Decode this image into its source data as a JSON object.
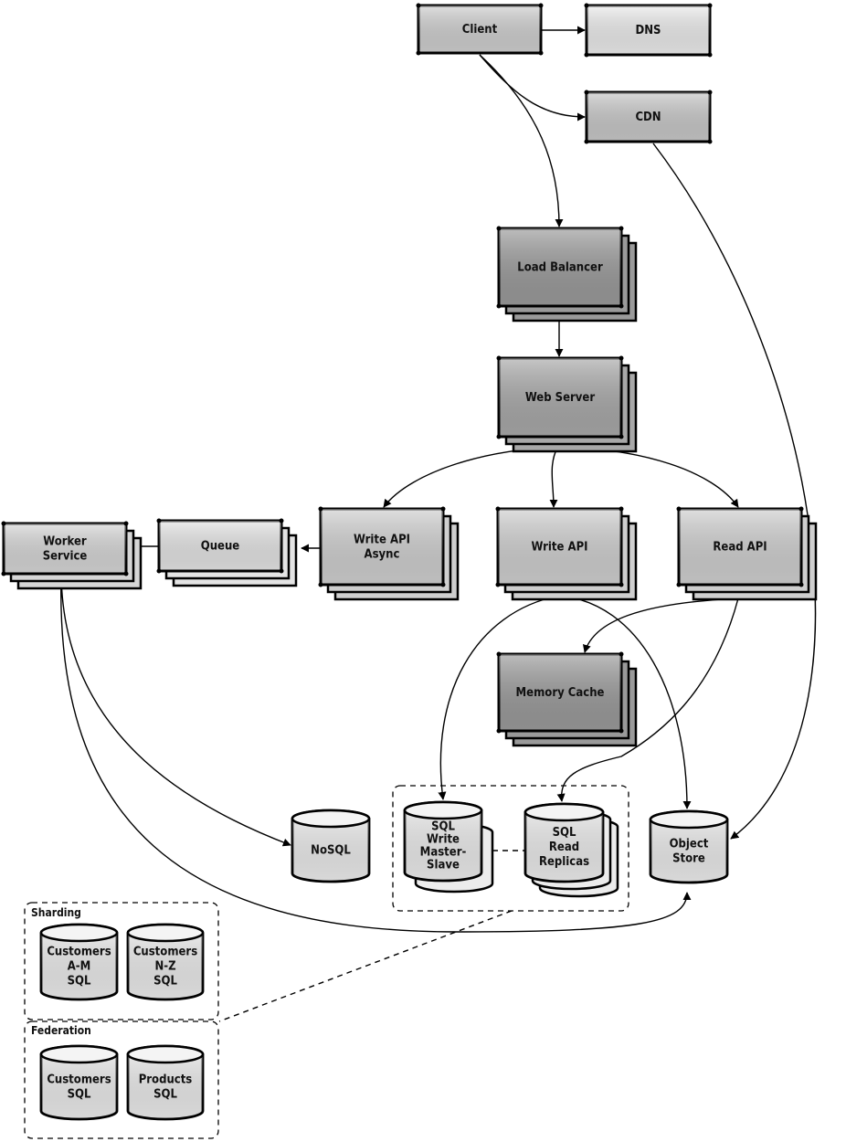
{
  "nodes": {
    "client": {
      "lines": [
        "Client"
      ],
      "shape": "box",
      "fill": "#cfcfcf"
    },
    "dns": {
      "lines": [
        "DNS"
      ],
      "shape": "box",
      "fill": "#ececec"
    },
    "cdn": {
      "lines": [
        "CDN"
      ],
      "shape": "box",
      "fill": "#c8c8c8"
    },
    "load_balancer": {
      "lines": [
        "Load Balancer"
      ],
      "shape": "stacked-box",
      "fill": "#9a9a9a"
    },
    "web_server": {
      "lines": [
        "Web Server"
      ],
      "shape": "stacked-box",
      "fill": "#a8a8a8"
    },
    "write_api_async": {
      "lines": [
        "Write API",
        "Async"
      ],
      "shape": "stacked-box",
      "fill": "#cfcfcf"
    },
    "write_api": {
      "lines": [
        "Write API"
      ],
      "shape": "stacked-box",
      "fill": "#cfcfcf"
    },
    "read_api": {
      "lines": [
        "Read API"
      ],
      "shape": "stacked-box",
      "fill": "#cfcfcf"
    },
    "queue": {
      "lines": [
        "Queue"
      ],
      "shape": "stacked-box",
      "fill": "#e4e4e4"
    },
    "worker_service": {
      "lines": [
        "Worker",
        "Service"
      ],
      "shape": "stacked-box",
      "fill": "#d6d6d6"
    },
    "memory_cache": {
      "lines": [
        "Memory Cache"
      ],
      "shape": "stacked-box",
      "fill": "#9a9a9a"
    },
    "nosql": {
      "lines": [
        "NoSQL"
      ],
      "shape": "cylinder",
      "fill": "#ececec"
    },
    "sql_write": {
      "lines": [
        "SQL",
        "Write",
        "Master-",
        "Slave"
      ],
      "shape": "stacked-cylinder",
      "fill": "#ececec"
    },
    "sql_read": {
      "lines": [
        "SQL",
        "Read",
        "Replicas"
      ],
      "shape": "stacked-cylinder",
      "fill": "#ececec"
    },
    "object_store": {
      "lines": [
        "Object",
        "Store"
      ],
      "shape": "cylinder",
      "fill": "#ececec"
    },
    "customers_am": {
      "lines": [
        "Customers",
        "A-M",
        "SQL"
      ],
      "shape": "cylinder",
      "fill": "#ececec"
    },
    "customers_nz": {
      "lines": [
        "Customers",
        "N-Z",
        "SQL"
      ],
      "shape": "cylinder",
      "fill": "#ececec"
    },
    "customers_sql": {
      "lines": [
        "Customers",
        "SQL"
      ],
      "shape": "cylinder",
      "fill": "#ececec"
    },
    "products_sql": {
      "lines": [
        "Products",
        "SQL"
      ],
      "shape": "cylinder",
      "fill": "#ececec"
    }
  },
  "groups": {
    "sharding": {
      "label": "Sharding"
    },
    "federation": {
      "label": "Federation"
    }
  },
  "edges": [
    {
      "from": "client",
      "to": "dns"
    },
    {
      "from": "client",
      "to": "cdn"
    },
    {
      "from": "client",
      "to": "load_balancer"
    },
    {
      "from": "cdn",
      "to": "object_store"
    },
    {
      "from": "load_balancer",
      "to": "web_server"
    },
    {
      "from": "web_server",
      "to": "write_api_async"
    },
    {
      "from": "web_server",
      "to": "write_api"
    },
    {
      "from": "web_server",
      "to": "read_api"
    },
    {
      "from": "write_api_async",
      "to": "queue"
    },
    {
      "from": "queue",
      "to": "worker_service"
    },
    {
      "from": "worker_service",
      "to": "nosql"
    },
    {
      "from": "worker_service",
      "to": "object_store"
    },
    {
      "from": "write_api",
      "to": "sql_write"
    },
    {
      "from": "write_api",
      "to": "object_store"
    },
    {
      "from": "read_api",
      "to": "memory_cache"
    },
    {
      "from": "read_api",
      "to": "sql_read"
    },
    {
      "from": "sql_write",
      "to": "sql_read",
      "style": "dashed"
    },
    {
      "from": "sql_group",
      "to": "sharding_federation",
      "style": "dashed"
    }
  ]
}
